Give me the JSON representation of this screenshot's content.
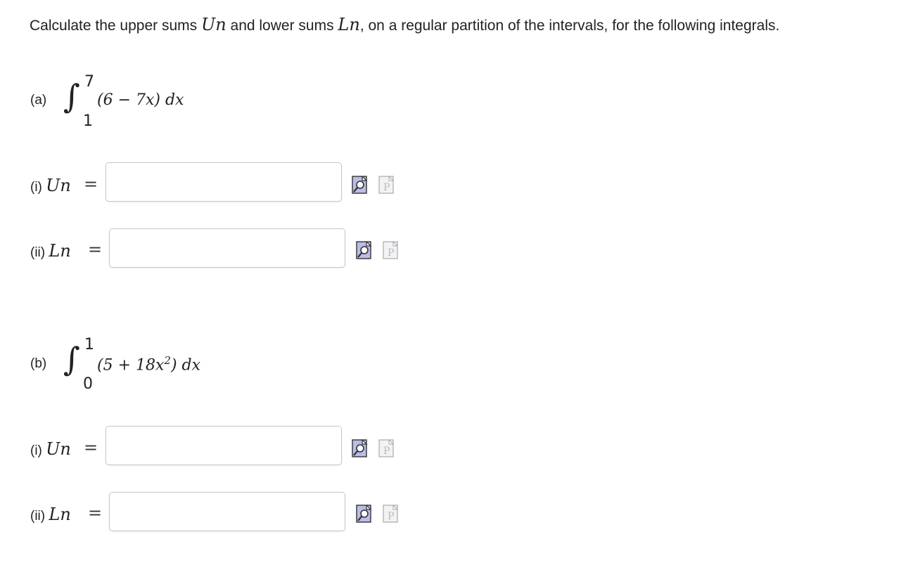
{
  "instructions": {
    "text_before": "Calculate the upper sums",
    "upper_symbol": "Un",
    "text_middle": "and lower sums",
    "lower_symbol": "Ln",
    "text_after": ", on a regular partition of the intervals, for the following integrals."
  },
  "parts": [
    {
      "label": "(a)",
      "upper_limit": "7",
      "lower_limit": "1",
      "integrand": "(6 − 7x) dx",
      "rows": [
        {
          "label": "(i)",
          "symbol": "Un",
          "equals": "=",
          "value": "",
          "placeholder": ""
        },
        {
          "label": "(ii)",
          "symbol": "Ln",
          "equals": "=",
          "value": "",
          "placeholder": ""
        }
      ]
    },
    {
      "label": "(b)",
      "upper_limit": "1",
      "lower_limit": "0",
      "integrand_pre": "(5 + 18x",
      "integrand_exp": "2",
      "integrand_post": ") dx",
      "rows": [
        {
          "label": "(i)",
          "symbol": "Un",
          "equals": "=",
          "value": "",
          "placeholder": ""
        },
        {
          "label": "(ii)",
          "symbol": "Ln",
          "equals": "=",
          "value": "",
          "placeholder": ""
        }
      ]
    }
  ],
  "icons": {
    "preview": "preview-magnifier-icon",
    "palette": "math-palette-icon",
    "preview_color": "#b9bde8",
    "palette_color": "#f3f3f6"
  }
}
